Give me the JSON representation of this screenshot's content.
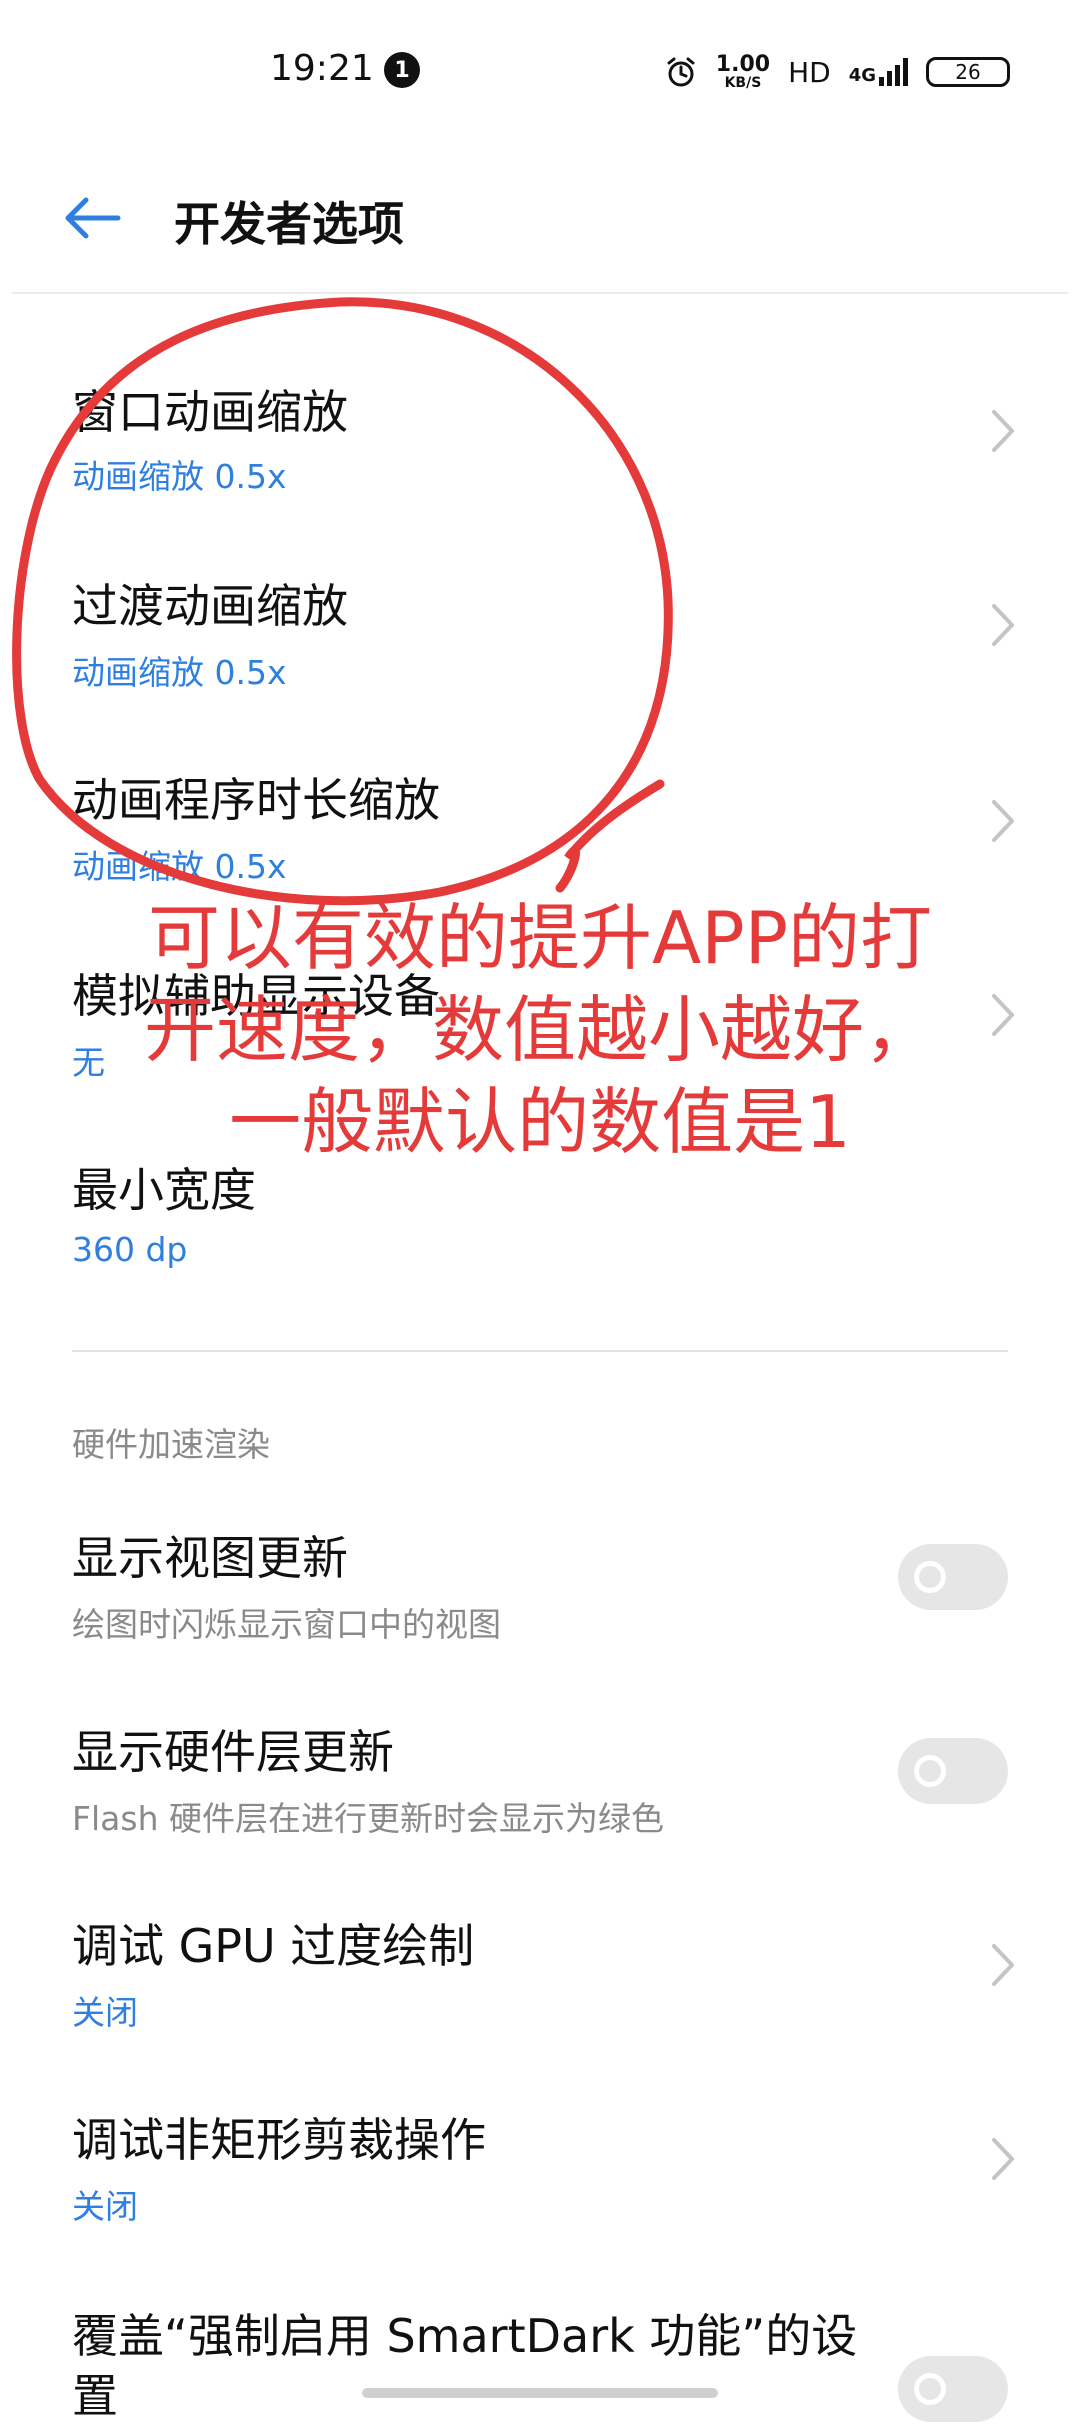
{
  "status_bar": {
    "time": "19:21",
    "notification_count": "1",
    "net_speed_value": "1.00",
    "net_speed_unit": "KB/S",
    "hd": "HD",
    "network": "4G",
    "battery": "26"
  },
  "header": {
    "title": "开发者选项"
  },
  "items": [
    {
      "title": "窗口动画缩放",
      "subtitle": "动画缩放 0.5x"
    },
    {
      "title": "过渡动画缩放",
      "subtitle": "动画缩放 0.5x"
    },
    {
      "title": "动画程序时长缩放",
      "subtitle": "动画缩放 0.5x"
    },
    {
      "title": "模拟辅助显示设备",
      "subtitle": "无"
    },
    {
      "title": "最小宽度",
      "subtitle": "360 dp"
    }
  ],
  "section": {
    "header": "硬件加速渲染"
  },
  "hw_items": [
    {
      "title": "显示视图更新",
      "subtitle": "绘图时闪烁显示窗口中的视图",
      "toggle_on": false
    },
    {
      "title": "显示硬件层更新",
      "subtitle": "Flash 硬件层在进行更新时会显示为绿色",
      "toggle_on": false
    },
    {
      "title": "调试 GPU 过度绘制",
      "subtitle": "关闭"
    },
    {
      "title": "调试非矩形剪裁操作",
      "subtitle": "关闭"
    },
    {
      "title": "覆盖“强制启用 SmartDark 功能”的设",
      "title_line2": "置",
      "toggle_on": false
    }
  ],
  "annotation": {
    "line1": "可以有效的提升APP的打",
    "line2": "开速度，数值越小越好，",
    "line3": "一般默认的数值是1",
    "color": "#e53a3a"
  },
  "colors": {
    "accent": "#2f7fe0",
    "annotation": "#e53a3a"
  }
}
